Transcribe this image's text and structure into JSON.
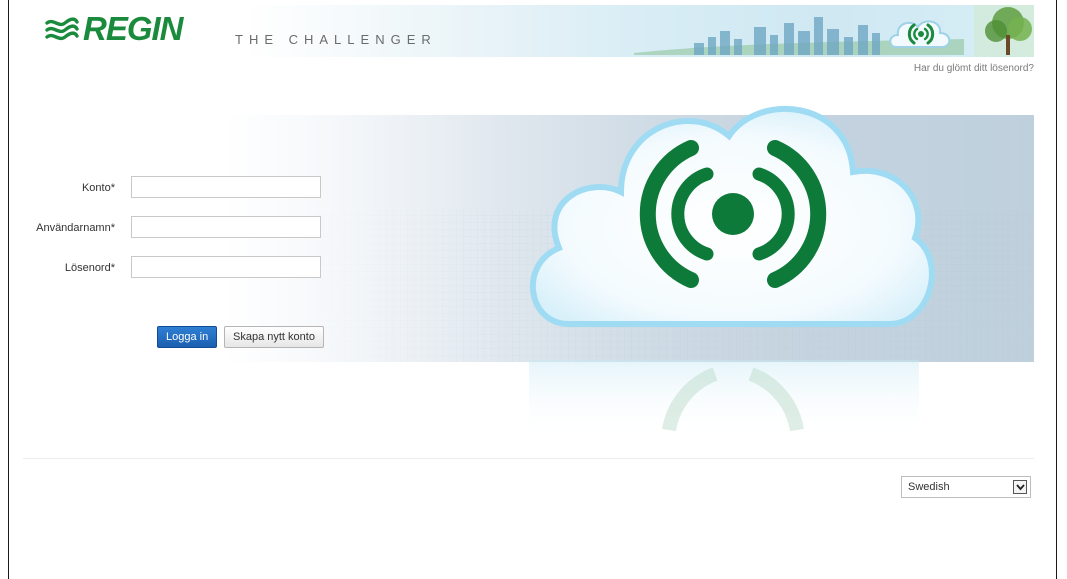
{
  "header": {
    "logo_text": "REGIN",
    "tagline": "THE CHALLENGER",
    "forgot_password": "Har du glömt ditt lösenord?"
  },
  "form": {
    "account_label": "Konto*",
    "account_value": "",
    "username_label": "Användarnamn*",
    "username_value": "",
    "password_label": "Lösenord*",
    "password_value": "",
    "login_button": "Logga in",
    "create_account_button": "Skapa nytt konto"
  },
  "language": {
    "selected": "Swedish"
  },
  "colors": {
    "brand_green": "#1a8a3c",
    "primary_blue": "#1b5fb0"
  }
}
